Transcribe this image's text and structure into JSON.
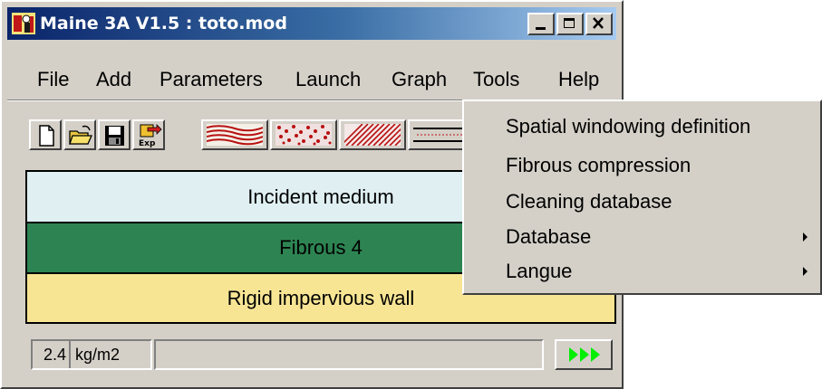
{
  "window": {
    "title": "Maine 3A V1.5 : toto.mod"
  },
  "menubar": {
    "items": [
      "File",
      "Add",
      "Parameters",
      "Launch",
      "Graph",
      "Tools",
      "Help"
    ]
  },
  "toolbar": {
    "buttons": [
      {
        "icon": "new-document-icon"
      },
      {
        "icon": "open-folder-icon"
      },
      {
        "icon": "save-disk-icon"
      },
      {
        "icon": "export-icon",
        "text": "Exp"
      }
    ],
    "layer_buttons": [
      {
        "icon": "wavy-layer-icon"
      },
      {
        "icon": "porous-layer-icon"
      },
      {
        "icon": "hatched-layer-icon"
      },
      {
        "icon": "thin-layer-icon"
      }
    ]
  },
  "layers": [
    {
      "label": "Incident medium",
      "color": "#dfeff2"
    },
    {
      "label": "Fibrous 4",
      "color": "#2d8452"
    },
    {
      "label": "Rigid impervious wall",
      "color": "#f8e594"
    }
  ],
  "statusbar": {
    "mass_value": "2.4",
    "mass_unit": "kg/m2",
    "run_icon": "run-arrows-icon",
    "run_color": "#00ee00"
  },
  "tools_menu": {
    "items": [
      {
        "label": "Spatial windowing definition",
        "submenu": false
      },
      {
        "label": "Fibrous compression",
        "submenu": false
      },
      {
        "label": "Cleaning database",
        "submenu": false
      },
      {
        "label": "Database",
        "submenu": true
      },
      {
        "label": "Langue",
        "submenu": true
      }
    ]
  }
}
